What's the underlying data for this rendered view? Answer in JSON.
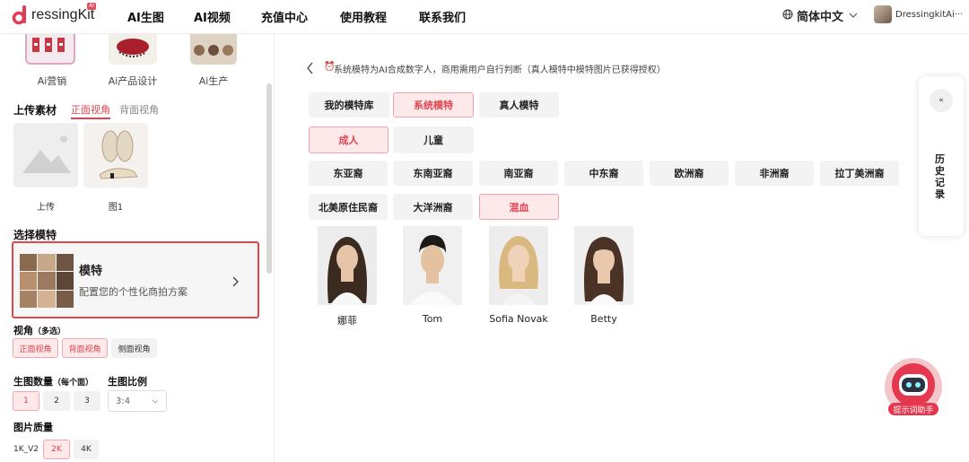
{
  "header": {
    "logo_text": "ressingKit",
    "logo_badge": "AI",
    "nav": [
      "AI生图",
      "AI视频",
      "充值中心",
      "使用教程",
      "联系我们"
    ],
    "language": "简体中文",
    "username": "DressingkitAi···"
  },
  "sidebar": {
    "categories": [
      "Ai营销",
      "Ai产品设计",
      "Ai生产"
    ],
    "upload": {
      "title": "上传素材",
      "tabs": [
        "正面视角",
        "背面视角"
      ],
      "items": [
        "上传",
        "图1"
      ]
    },
    "model_select": {
      "title": "选择模特",
      "card_title": "模特",
      "card_desc": "配置您的个性化商拍方案"
    },
    "view_angle": {
      "label": "视角",
      "hint": "（多选）",
      "options": [
        "正面视角",
        "背面视角",
        "侧面视角"
      ]
    },
    "quantity": {
      "label": "生图数量",
      "hint": "（每个面）",
      "options": [
        "1",
        "2",
        "3"
      ]
    },
    "ratio": {
      "label": "生图比例",
      "value": "3:4"
    },
    "quality": {
      "label": "图片质量",
      "options": [
        "1K_V2",
        "2K",
        "4K"
      ]
    }
  },
  "main": {
    "notice": "系统模特为AI合成数字人，商用需用户自行判断（真人模特中模特图片已获得授权）",
    "source_tabs": [
      "我的模特库",
      "系统模特",
      "真人模特"
    ],
    "age_tabs": [
      "成人",
      "儿童"
    ],
    "ethnicities": [
      "东亚裔",
      "东南亚裔",
      "南亚裔",
      "中东裔",
      "欧洲裔",
      "非洲裔",
      "拉丁美洲裔",
      "北美原住民裔",
      "大洋洲裔",
      "混血"
    ],
    "models": [
      "娜菲",
      "Tom",
      "Sofia Novak",
      "Betty"
    ]
  },
  "history": {
    "toggle": "«",
    "label": "历史记录"
  },
  "assistant": {
    "label": "提示词助手"
  },
  "colors": {
    "accent": "#e0454f",
    "accent_bg": "#fde8ea"
  }
}
